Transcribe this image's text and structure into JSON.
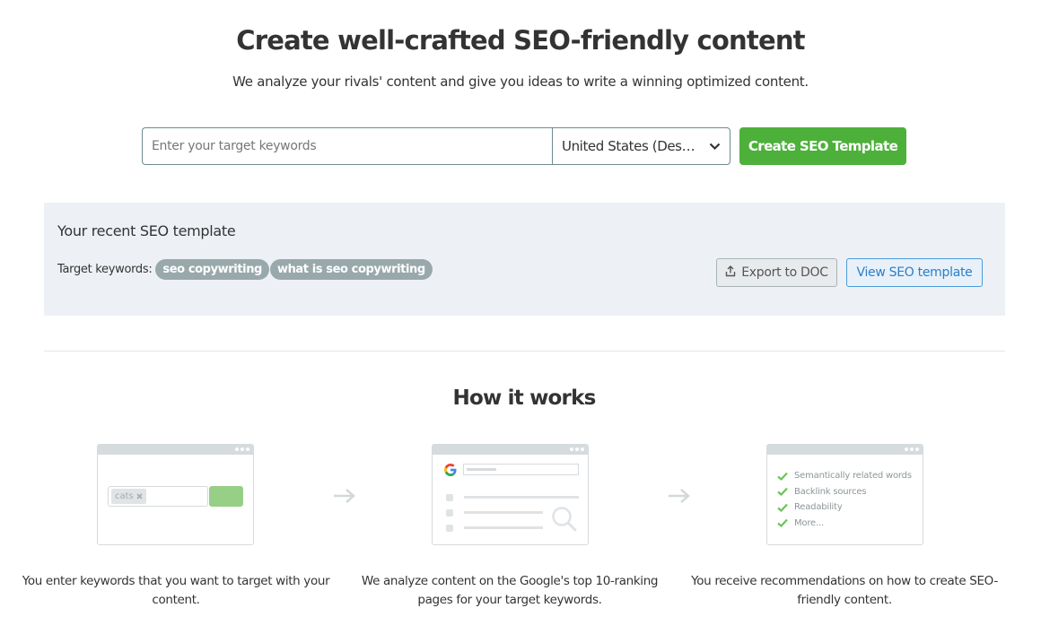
{
  "hero": {
    "title": "Create well-crafted SEO-friendly content",
    "subtitle": "We analyze your rivals' content and give you ideas to write a winning optimized content."
  },
  "search": {
    "keywords_placeholder": "Enter your target keywords",
    "keywords_value": "",
    "country_value": "United States (Des…",
    "create_button": "Create SEO Template"
  },
  "recent": {
    "title": "Your recent SEO template",
    "keywords_label": "Target keywords:",
    "keywords": [
      "seo copywriting",
      "what is seo copywriting"
    ],
    "export_button": "Export to DOC",
    "view_button": "View SEO template"
  },
  "how_it_works": {
    "title": "How it works",
    "steps": [
      {
        "illustration": "keyword-input-illustration",
        "chip_text": "cats",
        "text": "You enter keywords that you want to target with your content."
      },
      {
        "illustration": "google-results-illustration",
        "text": "We analyze content on the Google's top 10-ranking pages for your target keywords."
      },
      {
        "illustration": "recommendations-illustration",
        "checklist": [
          "Semantically related words",
          "Backlink sources",
          "Readability",
          "More..."
        ],
        "text": "You receive recommendations on how to create SEO-friendly content."
      }
    ]
  },
  "colors": {
    "primary_green": "#4db03a",
    "panel_bg": "#edf1f5",
    "chip_bg": "#99a9ab",
    "link_blue": "#2b7ec7",
    "check_green": "#6cc35a"
  }
}
